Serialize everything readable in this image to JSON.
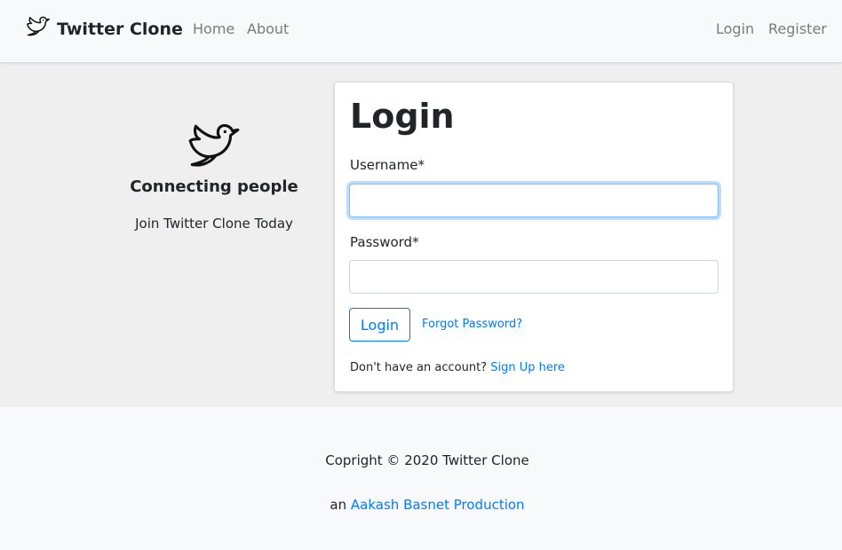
{
  "navbar": {
    "brand_icon": "twitter-bird-icon",
    "brand": "Twitter Clone",
    "links_left": [
      "Home",
      "About"
    ],
    "links_right": [
      "Login",
      "Register"
    ]
  },
  "hero": {
    "icon": "twitter-bird-icon",
    "title": "Connecting people",
    "subtitle": "Join Twitter Clone Today"
  },
  "login_card": {
    "title": "Login",
    "username_label": "Username*",
    "username_value": "",
    "password_label": "Password*",
    "password_value": "",
    "submit_label": "Login",
    "forgot_label": "Forgot Password?",
    "signup_prompt": "Don't have an account?",
    "signup_link": "Sign Up here"
  },
  "footer": {
    "copyright": "Copright © 2020 Twitter Clone",
    "production_prefix": "an",
    "production_link": "Aakash Basnet Production"
  },
  "colors": {
    "accent": "#007bff",
    "nav_bg": "#f8f9fa",
    "main_bg": "#efefef"
  }
}
